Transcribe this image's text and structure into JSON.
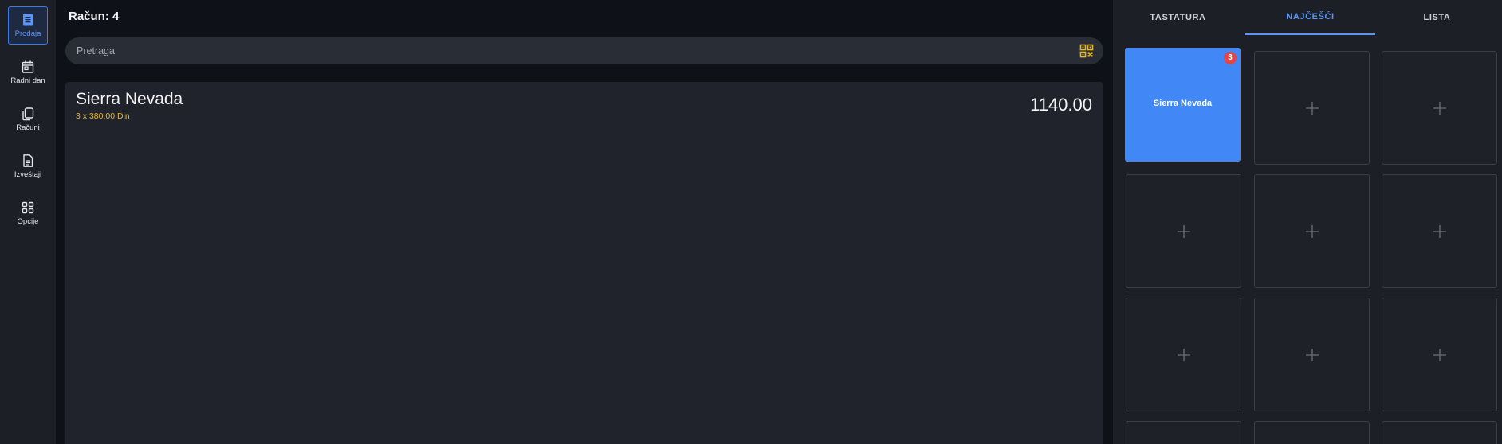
{
  "nav": {
    "items": [
      {
        "label": "Prodaja",
        "icon": "receipt-icon",
        "active": true
      },
      {
        "label": "Radni dan",
        "icon": "calendar-icon",
        "active": false
      },
      {
        "label": "Računi",
        "icon": "copy-icon",
        "active": false
      },
      {
        "label": "Izveštaji",
        "icon": "document-icon",
        "active": false
      },
      {
        "label": "Opcije",
        "icon": "grid-icon",
        "active": false
      }
    ]
  },
  "header": {
    "title": "Račun: 4"
  },
  "search": {
    "placeholder": "Pretraga",
    "scan_icon": "qr-code-icon"
  },
  "order": {
    "items": [
      {
        "name": "Sierra Nevada",
        "detail": "3 x 380.00 Din",
        "total": "1140.00"
      }
    ]
  },
  "panel": {
    "tabs": [
      {
        "label": "TASTATURA",
        "active": false
      },
      {
        "label": "NAJČEŠĆI",
        "active": true
      },
      {
        "label": "LISTA",
        "active": false
      }
    ],
    "tiles": [
      {
        "name": "Sierra Nevada",
        "badge": "3"
      }
    ],
    "empty_tile_icon": "plus-icon"
  },
  "colors": {
    "accent": "#4187f5",
    "badge": "#e34646",
    "highlight": "#e4b92b",
    "background": "#0e1117",
    "panel": "#1c1f26"
  }
}
